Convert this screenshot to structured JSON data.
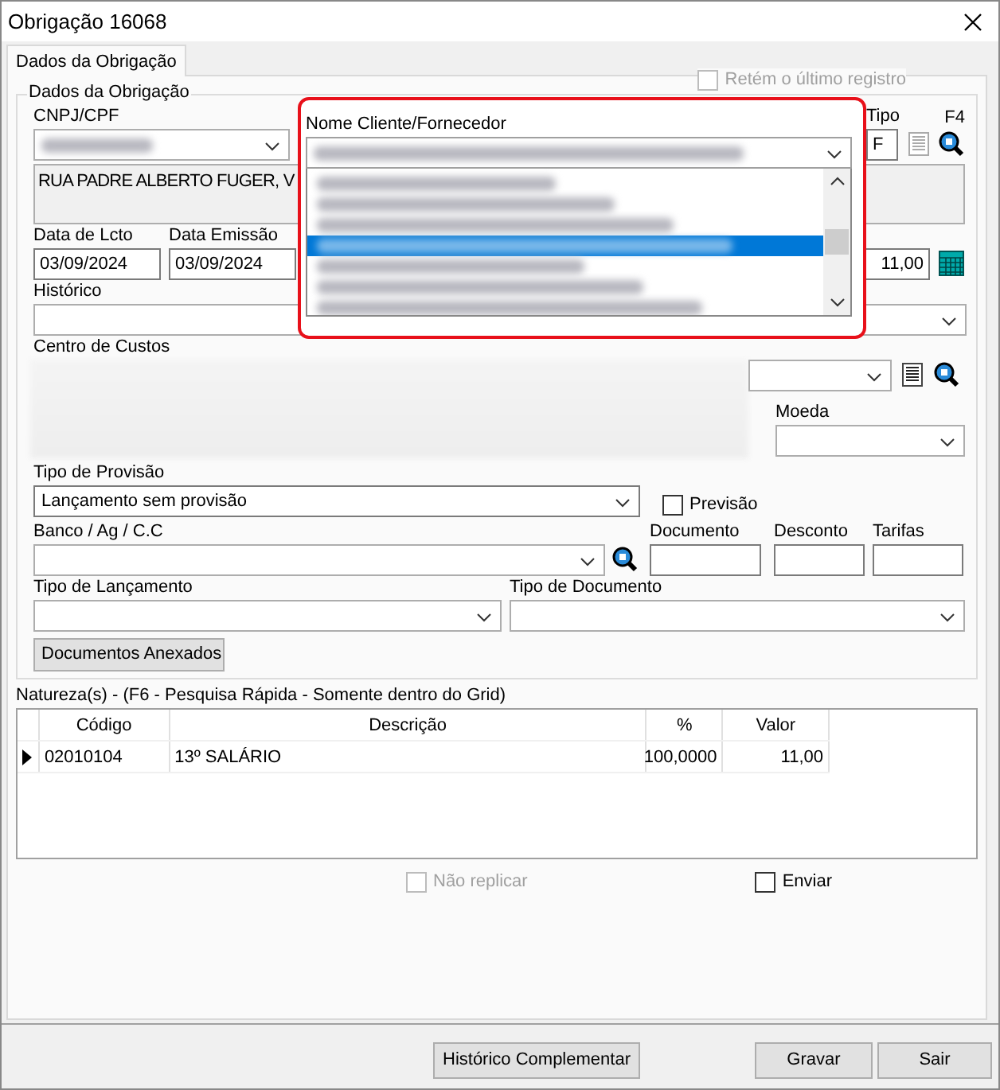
{
  "window": {
    "title": "Obrigação 16068"
  },
  "tabs": [
    {
      "label": "Dados da Obrigação",
      "selected": true
    }
  ],
  "group": {
    "title": "Dados da Obrigação"
  },
  "retain_last": {
    "label": "Retém o último registro",
    "checked": false,
    "disabled": true
  },
  "cnpj": {
    "label": "CNPJ/CPF"
  },
  "client": {
    "label": "Nome Cliente/Fornecedor",
    "options": [
      {
        "selected": false
      },
      {
        "selected": false
      },
      {
        "selected": false
      },
      {
        "selected": true
      },
      {
        "selected": false
      },
      {
        "selected": false
      },
      {
        "selected": false
      }
    ]
  },
  "tipo": {
    "label": "Tipo",
    "value": "F"
  },
  "f4_label": "F4",
  "address": "RUA PADRE ALBERTO FUGER, V",
  "dates": [
    {
      "label": "Data de Lcto",
      "value": "03/09/2024"
    },
    {
      "label": "Data Emissão",
      "value": "03/09/2024"
    }
  ],
  "amount": "11,00",
  "historico": {
    "label": "Histórico"
  },
  "centro_custos": {
    "label": "Centro de Custos"
  },
  "moeda": {
    "label": "Moeda"
  },
  "tipo_provisao": {
    "label": "Tipo de Provisão",
    "value": "Lançamento sem provisão"
  },
  "previsao": {
    "label": "Previsão",
    "checked": false,
    "disabled": false
  },
  "banco": {
    "label": "Banco / Ag / C.C"
  },
  "documento": {
    "label": "Documento"
  },
  "desconto": {
    "label": "Desconto"
  },
  "tarifas": {
    "label": "Tarifas"
  },
  "tipo_lancamento": {
    "label": "Tipo de Lançamento"
  },
  "tipo_documento": {
    "label": "Tipo de Documento"
  },
  "attachments_button": "Documentos Anexados",
  "grid": {
    "title": "Natureza(s) - (F6 - Pesquisa Rápida - Somente dentro do Grid)",
    "columns": [
      "Código",
      "Descrição",
      "%",
      "Valor"
    ],
    "rows": [
      {
        "cells": [
          "02010104",
          "13º SALÁRIO",
          "100,0000",
          "11,00"
        ],
        "selected": true
      }
    ]
  },
  "nao_replicar": {
    "label": "Não replicar",
    "checked": false,
    "disabled": true
  },
  "enviar": {
    "label": "Enviar",
    "checked": false,
    "disabled": false
  },
  "buttons": [
    {
      "label": "Histórico Complementar"
    },
    {
      "label": "Gravar"
    },
    {
      "label": "Sair"
    }
  ]
}
